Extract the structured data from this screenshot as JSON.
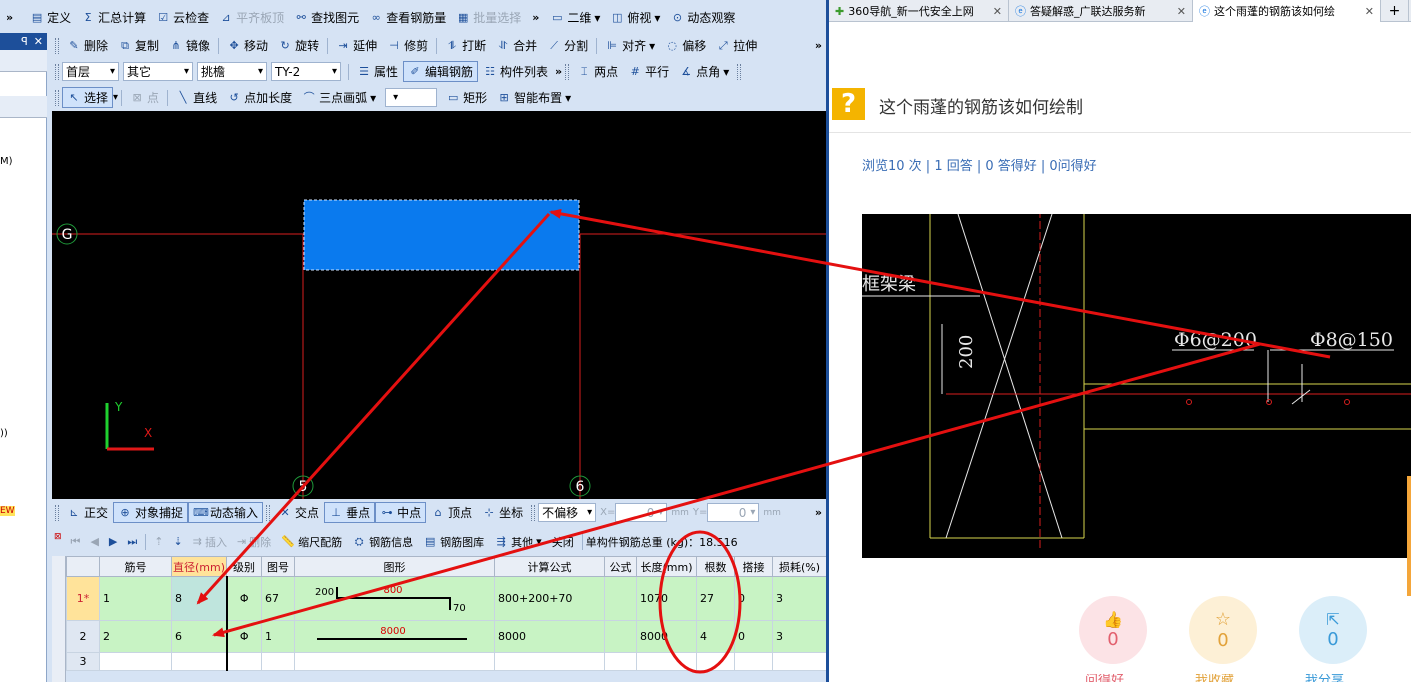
{
  "toolbar1": {
    "items": [
      "定义",
      "汇总计算",
      "云检查",
      "平齐板顶",
      "查找图元",
      "查看钢筋量",
      "批量选择",
      "二维",
      "俯视",
      "动态观察"
    ],
    "more": "»"
  },
  "toolbar2": {
    "items": [
      "删除",
      "复制",
      "镜像",
      "移动",
      "旋转",
      "延伸",
      "修剪",
      "打断",
      "合并",
      "分割",
      "对齐",
      "偏移",
      "拉伸"
    ],
    "more": "»"
  },
  "toolbar3": {
    "floor": "首层",
    "category": "其它",
    "type": "挑檐",
    "element": "TY-2",
    "items": [
      "属性",
      "编辑钢筋",
      "构件列表",
      "两点",
      "平行",
      "点角"
    ],
    "more": "»"
  },
  "toolbar4": {
    "items": [
      "选择",
      "点",
      "直线",
      "点加长度",
      "三点画弧",
      "矩形",
      "智能布置"
    ]
  },
  "left_panel": {
    "pin": "ꟼ",
    "close": "✕",
    "frag1": "M)",
    "frag2": "))",
    "frag3": "EW"
  },
  "canvas": {
    "axis_g": "G",
    "axis_5": "5",
    "axis_6": "6",
    "ucs_y": "Y",
    "ucs_x": "X"
  },
  "snapbar": {
    "items": [
      "正交",
      "对象捕捉",
      "动态输入",
      "交点",
      "垂点",
      "中点",
      "顶点",
      "坐标"
    ],
    "offset_mode": "不偏移",
    "x_label": "X=",
    "x_value": "0",
    "y_label": "Y=",
    "y_value": "0",
    "unit": "mm",
    "more": "»"
  },
  "rebar_toolbar": {
    "items": [
      "插入",
      "删除",
      "缩尺配筋",
      "钢筋信息",
      "钢筋图库",
      "其他",
      "关闭"
    ],
    "total_label": "单构件钢筋总重 (kg)：18.516"
  },
  "rebar_table": {
    "headers": [
      "筋号",
      "直径(mm)",
      "级别",
      "图号",
      "图形",
      "计算公式",
      "公式",
      "长度(mm)",
      "根数",
      "搭接",
      "损耗(%)"
    ],
    "rows": [
      {
        "row": "1*",
        "no": "1",
        "dia": "8",
        "grade": "Φ",
        "fig": "67",
        "formula": "800+200+70",
        "fdesc": "",
        "length": "1070",
        "count": "27",
        "lap": "0",
        "loss": "3",
        "shape_left": "200",
        "shape_mid": "800",
        "shape_right": "70"
      },
      {
        "row": "2",
        "no": "2",
        "dia": "6",
        "grade": "Φ",
        "fig": "1",
        "formula": "8000",
        "fdesc": "",
        "length": "8000",
        "count": "4",
        "lap": "0",
        "loss": "3",
        "shape_mid": "8000"
      },
      {
        "row": "3",
        "no": "",
        "dia": "",
        "grade": "",
        "fig": "",
        "formula": "",
        "fdesc": "",
        "length": "",
        "count": "",
        "lap": "",
        "loss": ""
      }
    ]
  },
  "browser": {
    "tabs": [
      {
        "title": "360导航_新一代安全上网"
      },
      {
        "title": "答疑解惑_广联达服务新"
      },
      {
        "title": "这个雨蓬的钢筋该如何绘"
      }
    ],
    "new_tab": "+",
    "question_title": "这个雨蓬的钢筋该如何绘制",
    "stats": "浏览10 次 | 1 回答 | 0 答得好 | 0问得好",
    "image_labels": {
      "beam": "框架梁",
      "dim": "200",
      "rebar1": "Φ6@200",
      "rebar2": "Φ8@150"
    },
    "actions": [
      {
        "count": "0",
        "label": "问得好",
        "color": "#fce3e6"
      },
      {
        "count": "0",
        "label": "我收藏",
        "color": "#fdf0d6"
      },
      {
        "count": "0",
        "label": "我分享",
        "color": "#dbeef9"
      }
    ]
  },
  "annotation_color": "#e41010"
}
